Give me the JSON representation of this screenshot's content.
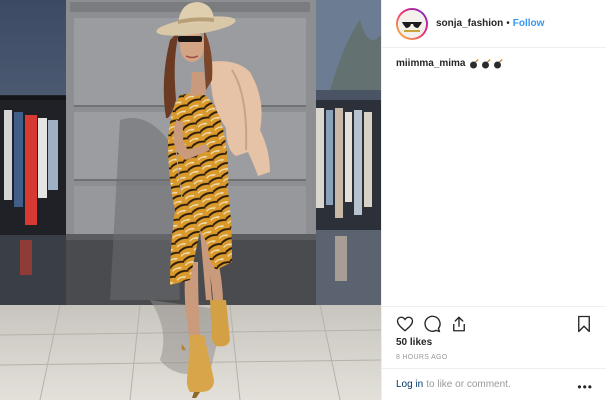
{
  "post": {
    "username": "sonja_fashion",
    "separator": "•",
    "follow_label": "Follow",
    "caption_user": "miimma_mima",
    "caption_emojis": [
      "bomb-emoji",
      "bomb-emoji",
      "bomb-emoji"
    ],
    "likes": "50 likes",
    "timestamp": "8 HOURS AGO",
    "login_label": "Log in",
    "login_suffix": "to like or comment.",
    "more_label": "•••"
  },
  "icons": {
    "like": "heart-icon",
    "comment": "comment-icon",
    "share": "share-icon",
    "save": "bookmark-icon"
  },
  "colors": {
    "link_blue": "#3897f0",
    "login_navy": "#003569",
    "muted": "#999999",
    "text": "#262626"
  }
}
